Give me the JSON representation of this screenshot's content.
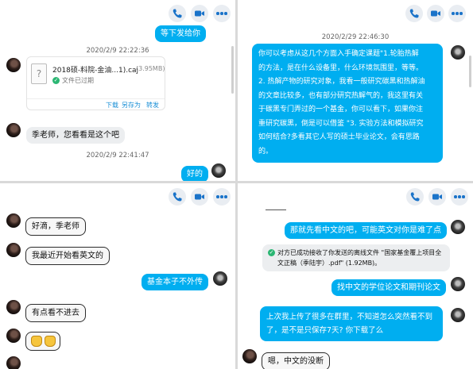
{
  "colors": {
    "bubble_blue": "#00aef0",
    "bubble_grey": "#eceef0",
    "header_icon": "#1a73c9"
  },
  "header_icons": [
    "phone-icon",
    "video-icon",
    "more-icon"
  ],
  "panel1": {
    "msg_top": "等下发给你",
    "timestamp1": "2020/2/9 22:22:36",
    "file": {
      "name": "2018硕-料院-金油...1).caj",
      "size": "(3.95MB)",
      "status": "文件已过期",
      "actions": [
        "下载",
        "另存为",
        "转发"
      ]
    },
    "msg_in": "季老师，您看看是这个吧",
    "timestamp2": "2020/2/9 22:41:47",
    "msg_out": "好的"
  },
  "panel2": {
    "timestamp": "2020/2/29 22:46:30",
    "msg_lines": [
      "你可以考虑从这几个方面入手确定课题\"1.轮胎热解",
      "的方法，是在什么设备里，什么环境氛围里，等等。",
      "2. 热解产物的研究对象，我看一般研究碳黑和热解油",
      "的文章比较多，也有部分研究热解气的，我这里有关",
      "于碳黑专门弄过的一个基金，你可以看下，如果你注",
      "重研究碳黑，倒是可以借鉴 \"3. 实验方法和模拟研究",
      "如何结合?多看其它人写的硕士毕业论文，会有思路",
      "的。"
    ]
  },
  "panel3": {
    "msgs": [
      "好滴，季老师",
      "我最近开始看英文的",
      "有点看不进去"
    ],
    "msg_out": "基金本子不外传",
    "emoji_label": "ok-hands-emoji"
  },
  "panel4": {
    "msg1": "那就先看中文的吧，可能英文对你是难了点",
    "notice_line1": "对方已成功接收了你发送的离线文件 \"国家基金覆上项目全",
    "notice_line2": "文正稿（季陆宇）.pdf\" (1.92MB)。",
    "msg2": "找中文的学位论文和期刊论文",
    "msg3_line1": "上次我上传了很多在群里，不知道怎么突然看不到",
    "msg3_line2": "了，是不是只保存7天? 你下载了么",
    "msg_in": "嗯，中文的没断"
  }
}
